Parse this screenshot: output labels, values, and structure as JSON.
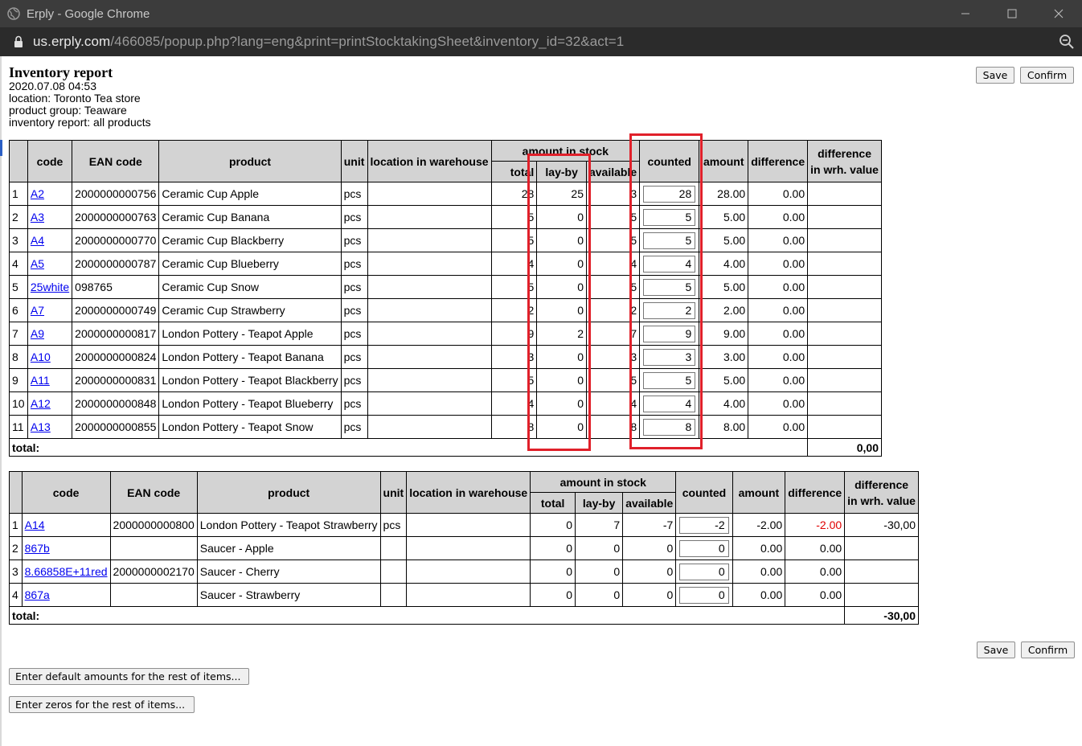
{
  "window": {
    "title": "Erply - Google Chrome"
  },
  "address_bar": {
    "domain": "us.erply.com",
    "path": "/466085/popup.php?lang=eng&print=printStocktakingSheet&inventory_id=32&act=1"
  },
  "report": {
    "title": "Inventory report",
    "date": "2020.07.08 04:53",
    "location": "location: Toronto Tea store",
    "product_group": "product group: Teaware",
    "scope": "inventory report: all products"
  },
  "buttons": {
    "save": "Save",
    "confirm": "Confirm",
    "enter_default": "Enter default amounts for the rest of items...",
    "enter_zeros": "Enter zeros for the rest of items..."
  },
  "columns": {
    "code": "code",
    "ean": "EAN code",
    "product": "product",
    "unit": "unit",
    "location": "location in warehouse",
    "amount_in_stock": "amount in stock",
    "total": "total",
    "layby": "lay-by",
    "available": "available",
    "counted": "counted",
    "amount": "amount",
    "difference": "difference",
    "diff_value_1": "difference",
    "diff_value_2": "in wrh. value"
  },
  "table1": {
    "rows": [
      {
        "n": "1",
        "code": "A2",
        "ean": "2000000000756",
        "product": "Ceramic Cup Apple",
        "unit": "pcs",
        "total": "28",
        "layby": "25",
        "available": "3",
        "counted": "28",
        "amount": "28.00",
        "difference": "0.00"
      },
      {
        "n": "2",
        "code": "A3",
        "ean": "2000000000763",
        "product": "Ceramic Cup Banana",
        "unit": "pcs",
        "total": "5",
        "layby": "0",
        "available": "5",
        "counted": "5",
        "amount": "5.00",
        "difference": "0.00"
      },
      {
        "n": "3",
        "code": "A4",
        "ean": "2000000000770",
        "product": "Ceramic Cup Blackberry",
        "unit": "pcs",
        "total": "5",
        "layby": "0",
        "available": "5",
        "counted": "5",
        "amount": "5.00",
        "difference": "0.00"
      },
      {
        "n": "4",
        "code": "A5",
        "ean": "2000000000787",
        "product": "Ceramic Cup Blueberry",
        "unit": "pcs",
        "total": "4",
        "layby": "0",
        "available": "4",
        "counted": "4",
        "amount": "4.00",
        "difference": "0.00"
      },
      {
        "n": "5",
        "code": "25white",
        "ean": "098765",
        "product": "Ceramic Cup Snow",
        "unit": "pcs",
        "total": "5",
        "layby": "0",
        "available": "5",
        "counted": "5",
        "amount": "5.00",
        "difference": "0.00"
      },
      {
        "n": "6",
        "code": "A7",
        "ean": "2000000000749",
        "product": "Ceramic Cup Strawberry",
        "unit": "pcs",
        "total": "2",
        "layby": "0",
        "available": "2",
        "counted": "2",
        "amount": "2.00",
        "difference": "0.00"
      },
      {
        "n": "7",
        "code": "A9",
        "ean": "2000000000817",
        "product": "London Pottery - Teapot Apple",
        "unit": "pcs",
        "total": "9",
        "layby": "2",
        "available": "7",
        "counted": "9",
        "amount": "9.00",
        "difference": "0.00"
      },
      {
        "n": "8",
        "code": "A10",
        "ean": "2000000000824",
        "product": "London Pottery - Teapot Banana",
        "unit": "pcs",
        "total": "3",
        "layby": "0",
        "available": "3",
        "counted": "3",
        "amount": "3.00",
        "difference": "0.00"
      },
      {
        "n": "9",
        "code": "A11",
        "ean": "2000000000831",
        "product": "London Pottery - Teapot Blackberry",
        "unit": "pcs",
        "total": "5",
        "layby": "0",
        "available": "5",
        "counted": "5",
        "amount": "5.00",
        "difference": "0.00"
      },
      {
        "n": "10",
        "code": "A12",
        "ean": "2000000000848",
        "product": "London Pottery - Teapot Blueberry",
        "unit": "pcs",
        "total": "4",
        "layby": "0",
        "available": "4",
        "counted": "4",
        "amount": "4.00",
        "difference": "0.00"
      },
      {
        "n": "11",
        "code": "A13",
        "ean": "2000000000855",
        "product": "London Pottery - Teapot Snow",
        "unit": "pcs",
        "total": "8",
        "layby": "0",
        "available": "8",
        "counted": "8",
        "amount": "8.00",
        "difference": "0.00"
      }
    ],
    "total_label": "total:",
    "total_value": "0,00"
  },
  "table2": {
    "rows": [
      {
        "n": "1",
        "code": "A14",
        "ean": "2000000000800",
        "product": "London Pottery - Teapot Strawberry",
        "unit": "pcs",
        "total": "0",
        "layby": "7",
        "available": "-7",
        "counted": "-2",
        "amount": "-2.00",
        "difference": "-2.00",
        "diff_value": "-30,00",
        "negative": true
      },
      {
        "n": "2",
        "code": "867b",
        "ean": "",
        "product": "Saucer - Apple",
        "unit": "",
        "total": "0",
        "layby": "0",
        "available": "0",
        "counted": "0",
        "amount": "0.00",
        "difference": "0.00",
        "diff_value": ""
      },
      {
        "n": "3",
        "code": "8.66858E+11red",
        "ean": "2000000002170",
        "product": "Saucer - Cherry",
        "unit": "",
        "total": "0",
        "layby": "0",
        "available": "0",
        "counted": "0",
        "amount": "0.00",
        "difference": "0.00",
        "diff_value": ""
      },
      {
        "n": "4",
        "code": "867a",
        "ean": "",
        "product": "Saucer - Strawberry",
        "unit": "",
        "total": "0",
        "layby": "0",
        "available": "0",
        "counted": "0",
        "amount": "0.00",
        "difference": "0.00",
        "diff_value": ""
      }
    ],
    "total_label": "total:",
    "total_value": "-30,00"
  },
  "colors": {
    "highlight": "#e0202a",
    "link": "#0000ee",
    "negative": "#e00000",
    "header_bg": "#d3d3d3"
  }
}
